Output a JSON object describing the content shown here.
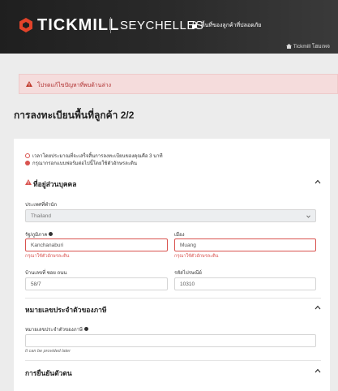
{
  "header": {
    "brand": "TICKMILL",
    "region": "SEYCHELLES",
    "secure_text": "พื้นที่ของลูกค้าที่ปลอดภัย",
    "home_link": "Tickmill โฮมเพจ"
  },
  "alert": {
    "text": "โปรดแก้ไขปัญหาที่พบด้านล่าง"
  },
  "page": {
    "title": "การลงทะเบียนพื้นที่ลูกค้า 2/2"
  },
  "info": {
    "time_note_prefix": "เวลาโดยประมาณที่จะเสร็จสิ้นการลงทะเบียนของคุณคือ",
    "time_value": "3",
    "time_unit": "นาที",
    "fill_note": "กรุณากรอกแบบฟอร์มต่อไปนี้โดยใช้ตัวอักษรละติน"
  },
  "sections": {
    "address": {
      "title": "ที่อยู่ส่วนบุคคล"
    },
    "tax": {
      "title": "หมายเลขประจำตัวของภาษี"
    },
    "verify": {
      "title": "การยืนยันตัวตน"
    }
  },
  "fields": {
    "country": {
      "label": "ประเทศที่พำนัก",
      "value": "Thailand"
    },
    "state": {
      "label": "รัฐ/ภูมิภาค",
      "value": "Kanchanaburi",
      "error": "กรุณาใช้ตัวอักษรละติน"
    },
    "city": {
      "label": "เมือง",
      "value": "Muang",
      "error": "กรุณาใช้ตัวอักษรละติน"
    },
    "street": {
      "label": "บ้านเลขที่ ซอย ถนน",
      "value": "58/7"
    },
    "zip": {
      "label": "รหัสไปรษณีย์",
      "value": "10310"
    },
    "tax_id": {
      "label": "หมายเลขประจำตัวของภาษี",
      "value": "",
      "hint": "It can be provided later"
    }
  },
  "colors": {
    "accent": "#d9534f",
    "header_bg": "#1f1f1f",
    "alert_bg": "#f5dcdc"
  }
}
